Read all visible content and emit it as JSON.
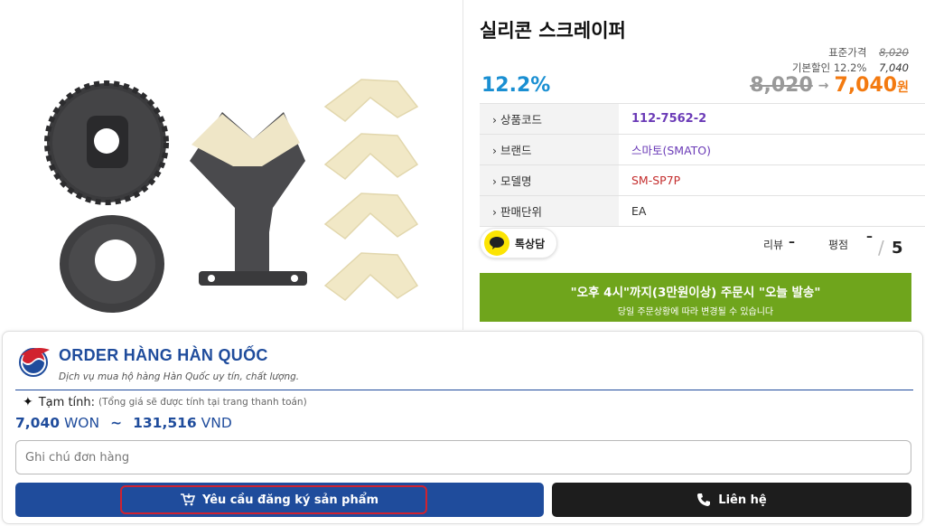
{
  "product": {
    "title": "실리콘 스크레이퍼",
    "list_price_label": "표준가격",
    "list_price": "8,020",
    "base_discount_label": "기본할인 12.2%",
    "base_discount_price": "7,040",
    "discount_percent": "12.2%",
    "old_price": "8,020",
    "arrow": "→",
    "new_price": "7,040",
    "currency": "원",
    "specs": [
      {
        "label": "› 상품코드",
        "value": "112-7562-2"
      },
      {
        "label": "› 브랜드",
        "value": "스마토(SMATO)"
      },
      {
        "label": "› 모델명",
        "value": "SM-SP7P"
      },
      {
        "label": "› 판매단위",
        "value": "EA"
      }
    ],
    "kakao_label": "톡상담",
    "review_label": "리뷰",
    "review_value": "–",
    "rating_label": "평점",
    "rating_value": "–",
    "rating_slash": "/",
    "rating_max": "5",
    "shipping_line1": "\"오후 4시\"까지(3만원이상) 주문시 \"오늘 발송\"",
    "shipping_line2": "당일 주문상황에 따라 변경될 수 있습니다"
  },
  "order_panel": {
    "brand_name": "ORDER HÀNG HÀN QUỐC",
    "tagline": "Dịch vụ mua hộ hàng Hàn Quốc uy tín, chất lượng.",
    "subtotal_label": "Tạm tính:",
    "subtotal_note": "(Tổng giá sẽ được tính tại trang thanh toán)",
    "amount_won_value": "7,040",
    "amount_won_unit": "WON",
    "amount_sep": "~",
    "amount_vnd_value": "131,516",
    "amount_vnd_unit": "VND",
    "note_placeholder": "Ghi chú đơn hàng",
    "request_button": "Yêu cầu đăng ký sản phẩm",
    "contact_button": "Liên hệ"
  },
  "colors": {
    "discount_blue": "#1a8fd2",
    "price_orange": "#f37a10",
    "code_purple": "#6b3bb7",
    "model_red": "#c42d2d",
    "shipping_green": "#6fa51c",
    "brand_blue": "#1f4c9c",
    "highlight_red": "#d1222f",
    "contact_black": "#1d1d1d"
  }
}
